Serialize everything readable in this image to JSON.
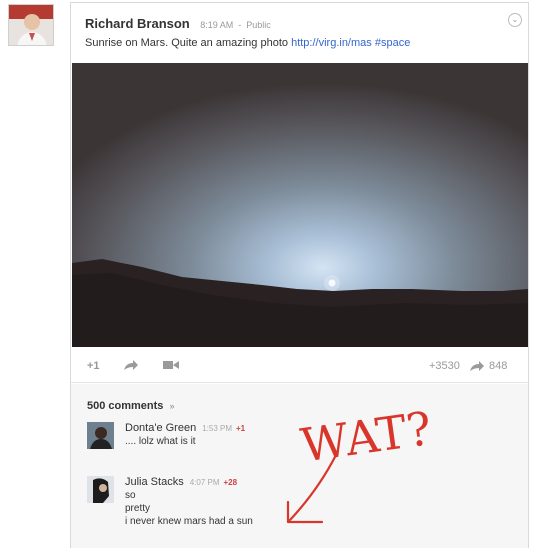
{
  "post": {
    "author": "Richard Branson",
    "time": "8:19 AM",
    "visibility": "Public",
    "text": "Sunrise on Mars. Quite an amazing photo",
    "link": "http://virg.in/mas",
    "hashtag": "#space"
  },
  "actions": {
    "plus_one": "+1",
    "share_icon": "share-arrow-icon",
    "hangout_icon": "video-camera-icon",
    "plus_count": "+3530",
    "share_count": "848"
  },
  "comments": {
    "count_label": "500 comments",
    "items": [
      {
        "name": "Donta'e Green",
        "time": "1:53 PM",
        "plus": "+1",
        "lines": [
          ".... lolz what is it"
        ]
      },
      {
        "name": "Julia Stacks",
        "time": "4:07 PM",
        "plus": "+28",
        "lines": [
          "so",
          "pretty",
          "i never knew mars had a sun"
        ]
      }
    ]
  },
  "annotation": {
    "text": "WAT?",
    "color": "#d9362b"
  },
  "colors": {
    "link": "#3366cc",
    "sky_glow": "#cfe0f0",
    "ground": "#2a2222"
  }
}
